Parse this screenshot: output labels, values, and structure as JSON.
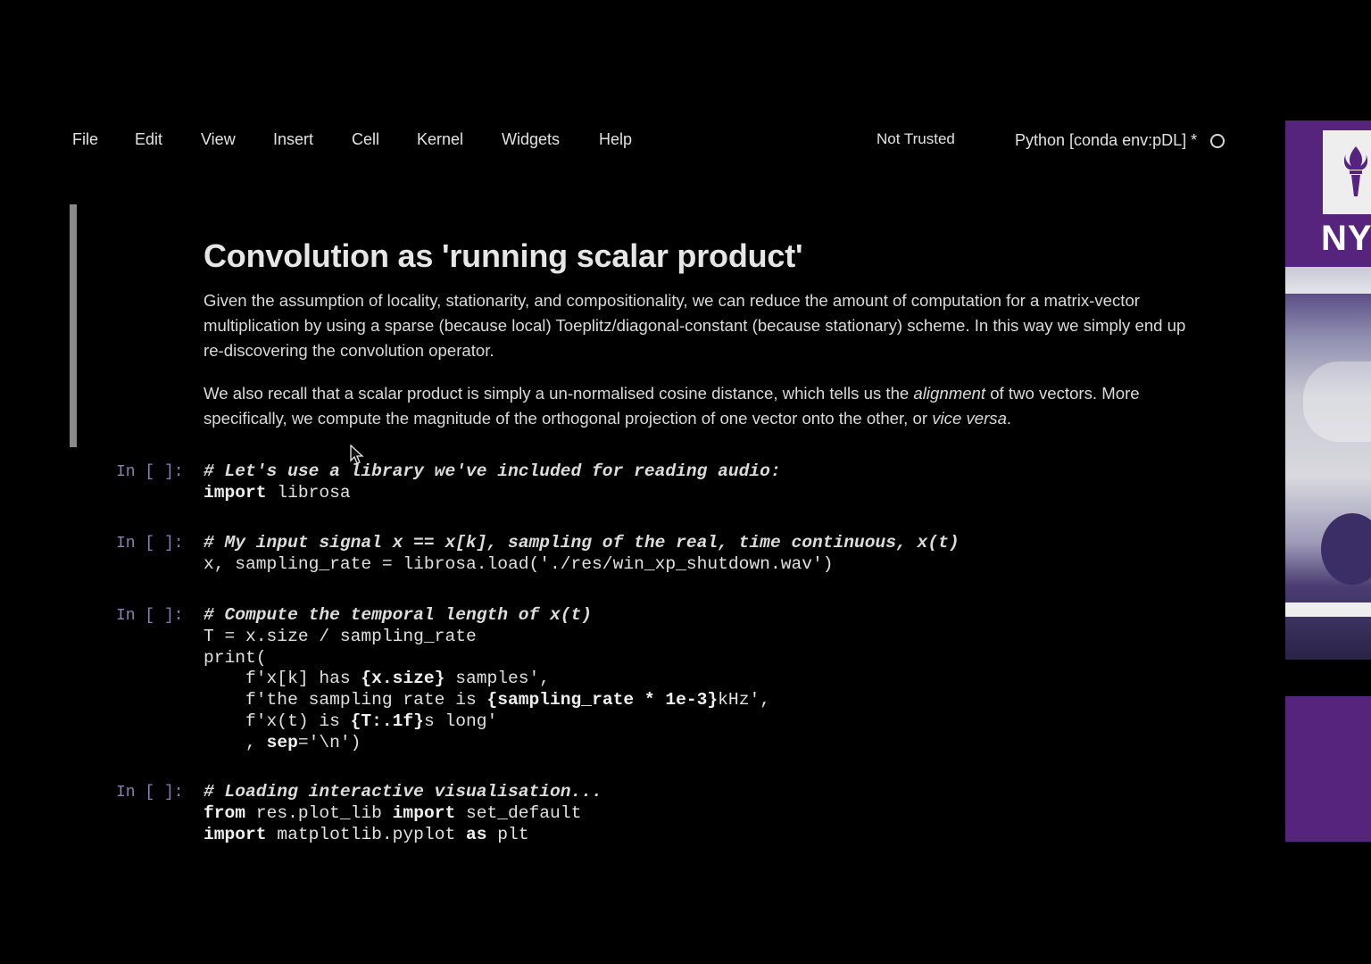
{
  "menubar": {
    "items": [
      "File",
      "Edit",
      "View",
      "Insert",
      "Cell",
      "Kernel",
      "Widgets",
      "Help"
    ],
    "trust_status": "Not Trusted",
    "kernel": "Python [conda env:pDL] *"
  },
  "markdown_cell": {
    "heading": "Convolution as 'running scalar product'",
    "para1": "Given the assumption of locality, stationarity, and compositionality, we can reduce the amount of computation for a matrix-vector multiplication by using a sparse (because local) Toeplitz/diagonal-constant (because stationary) scheme. In this way we simply end up re-discovering the convolution operator.",
    "para2_before": "We also recall that a scalar product is simply a un-normalised cosine distance, which tells us the ",
    "para2_em1": "alignment",
    "para2_mid": " of two vectors. More specifically, we compute the magnitude of the orthogonal projection of one vector onto the other, or ",
    "para2_em2": "vice versa",
    "para2_end": "."
  },
  "cells": [
    {
      "prompt": "In [ ]:",
      "lines": [
        [
          {
            "t": "cm",
            "s": "# Let's use a library we've included for reading audio:"
          }
        ],
        [
          {
            "t": "kw",
            "s": "import"
          },
          {
            "t": "tx",
            "s": " librosa"
          }
        ]
      ]
    },
    {
      "prompt": "In [ ]:",
      "lines": [
        [
          {
            "t": "cm",
            "s": "# My input signal x == x[k], sampling of the real, time continuous, x(t)"
          }
        ],
        [
          {
            "t": "tx",
            "s": "x, sampling_rate = librosa.load('./res/win_xp_shutdown.wav')"
          }
        ]
      ]
    },
    {
      "prompt": "In [ ]:",
      "lines": [
        [
          {
            "t": "cm",
            "s": "# Compute the temporal length of x(t)"
          }
        ],
        [
          {
            "t": "tx",
            "s": "T = x.size / sampling_rate"
          }
        ],
        [
          {
            "t": "tx",
            "s": "print("
          }
        ],
        [
          {
            "t": "tx",
            "s": "    f'x[k] has "
          },
          {
            "t": "kw",
            "s": "{x.size}"
          },
          {
            "t": "tx",
            "s": " samples',"
          }
        ],
        [
          {
            "t": "tx",
            "s": "    f'the sampling rate is "
          },
          {
            "t": "kw",
            "s": "{sampling_rate * 1e-3}"
          },
          {
            "t": "tx",
            "s": "kHz',"
          }
        ],
        [
          {
            "t": "tx",
            "s": "    f'x(t) is "
          },
          {
            "t": "kw",
            "s": "{T:.1f}"
          },
          {
            "t": "tx",
            "s": "s long'"
          }
        ],
        [
          {
            "t": "tx",
            "s": "    , "
          },
          {
            "t": "kw",
            "s": "sep"
          },
          {
            "t": "tx",
            "s": "='\\n')"
          }
        ]
      ]
    },
    {
      "prompt": "In [ ]:",
      "lines": [
        [
          {
            "t": "cm",
            "s": "# Loading interactive visualisation..."
          }
        ],
        [
          {
            "t": "kw",
            "s": "from"
          },
          {
            "t": "tx",
            "s": " res.plot_lib "
          },
          {
            "t": "kw",
            "s": "import"
          },
          {
            "t": "tx",
            "s": " set_default"
          }
        ],
        [
          {
            "t": "kw",
            "s": "import"
          },
          {
            "t": "tx",
            "s": " matplotlib.pyplot "
          },
          {
            "t": "kw",
            "s": "as"
          },
          {
            "t": "tx",
            "s": " plt"
          }
        ]
      ]
    }
  ],
  "side_panel": {
    "logo_text": "NY"
  }
}
